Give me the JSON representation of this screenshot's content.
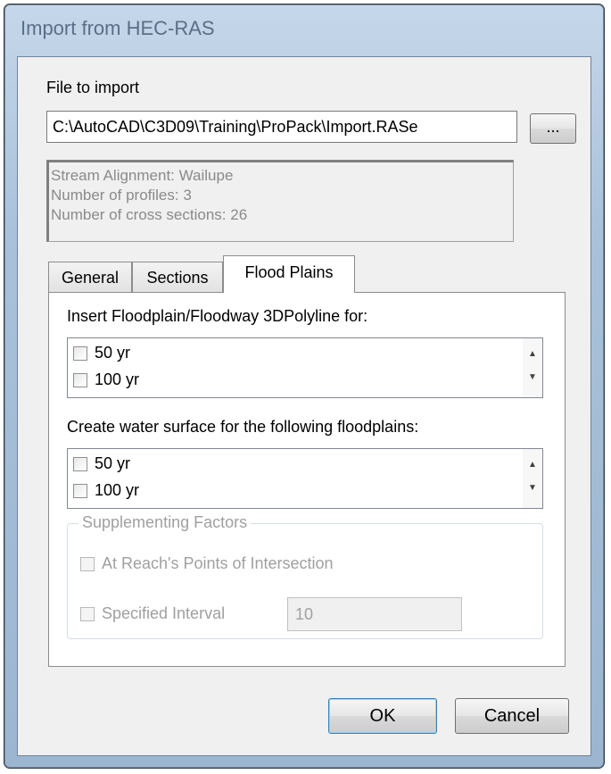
{
  "window": {
    "title": "Import from HEC-RAS"
  },
  "file": {
    "label": "File to import",
    "path": "C:\\AutoCAD\\C3D09\\Training\\ProPack\\Import.RASe",
    "browse_label": "..."
  },
  "info": {
    "lines": [
      "Stream Alignment: Wailupe",
      "Number of profiles: 3",
      "Number of cross sections: 26"
    ]
  },
  "tabs": [
    {
      "label": "General",
      "active": false
    },
    {
      "label": "Sections",
      "active": false
    },
    {
      "label": "Flood Plains",
      "active": true
    }
  ],
  "floodplain": {
    "insert_label": "Insert Floodplain/Floodway 3DPolyline for:",
    "insert_items": [
      {
        "label": "50 yr",
        "checked": false
      },
      {
        "label": "100 yr",
        "checked": false
      }
    ],
    "surface_label": "Create water surface for the following floodplains:",
    "surface_items": [
      {
        "label": "50 yr",
        "checked": false
      },
      {
        "label": "100 yr",
        "checked": false
      }
    ]
  },
  "supplementing": {
    "title": "Supplementing Factors",
    "reach_label": "At Reach's Points of Intersection",
    "interval_label": "Specified Interval",
    "interval_value": "10",
    "enabled": false
  },
  "buttons": {
    "ok": "OK",
    "cancel": "Cancel"
  },
  "icons": {
    "scroll_up": "up-arrow-icon",
    "scroll_down": "down-arrow-icon"
  }
}
